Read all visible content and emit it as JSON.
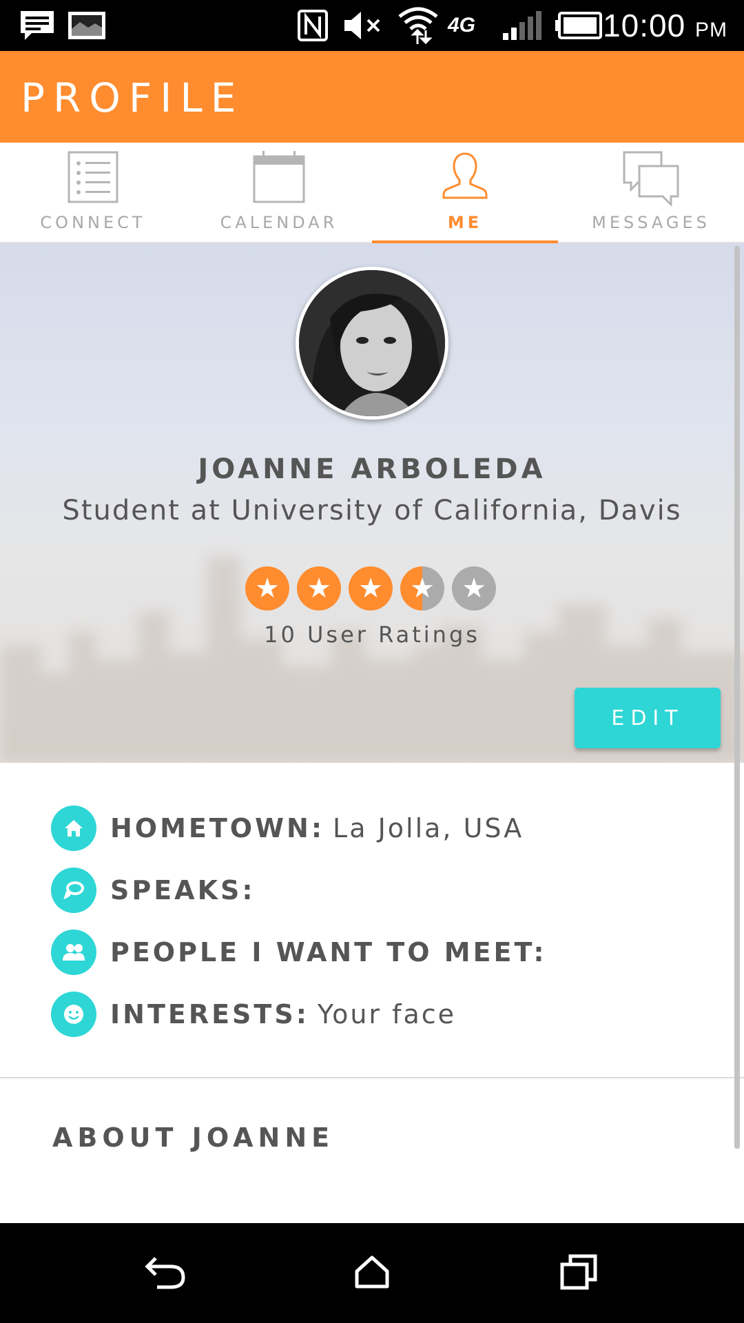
{
  "status_bar": {
    "time": "10:00",
    "time_suffix": "PM",
    "network": "4G",
    "icons": [
      "message-notification-icon",
      "image-notification-icon",
      "nfc-icon",
      "mute-icon",
      "wifi-icon",
      "signal-icon",
      "battery-icon"
    ]
  },
  "app_bar": {
    "title": "PROFILE"
  },
  "tabs": [
    {
      "label": "CONNECT",
      "icon": "list-icon",
      "active": false
    },
    {
      "label": "CALENDAR",
      "icon": "calendar-icon",
      "active": false
    },
    {
      "label": "ME",
      "icon": "person-icon",
      "active": true
    },
    {
      "label": "MESSAGES",
      "icon": "chat-bubbles-icon",
      "active": false
    }
  ],
  "profile": {
    "name": "JOANNE ARBOLEDA",
    "subtitle": "Student at University of California, Davis",
    "rating": 3.5,
    "rating_max": 5,
    "ratings_count_label": "10 User Ratings",
    "edit_label": "EDIT"
  },
  "details": [
    {
      "icon": "home-icon",
      "key": "HOMETOWN:",
      "value": "La Jolla, USA"
    },
    {
      "icon": "speech-bubble-icon",
      "key": "SPEAKS:",
      "value": ""
    },
    {
      "icon": "people-icon",
      "key": "PEOPLE I WANT TO MEET:",
      "value": ""
    },
    {
      "icon": "smiley-icon",
      "key": "INTERESTS:",
      "value": "Your face"
    }
  ],
  "about": {
    "heading": "ABOUT JOANNE"
  },
  "nav_bar": {
    "buttons": [
      "back-icon",
      "home-icon",
      "recents-icon"
    ]
  },
  "colors": {
    "accent": "#FF8C2F",
    "teal": "#2ED6D6",
    "text": "#555555",
    "inactive": "#a8a8a8"
  }
}
